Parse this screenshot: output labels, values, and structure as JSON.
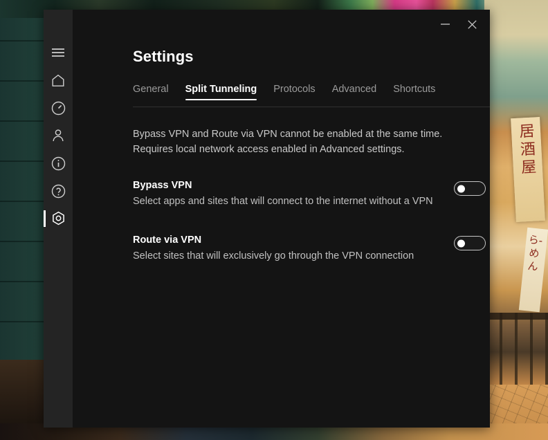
{
  "desktop": {
    "background_description": "japanese-street-photo",
    "sign_primary_text": "居酒屋",
    "sign_secondary_text": "ら-めん"
  },
  "window": {
    "titlebar": {
      "minimize_label": "—",
      "minimize_icon": "minimize-icon",
      "close_label": "✕",
      "close_icon": "close-icon"
    }
  },
  "sidebar": {
    "items": [
      {
        "id": "menu",
        "icon": "hamburger-menu-icon",
        "active": false
      },
      {
        "id": "home",
        "icon": "home-icon",
        "active": false
      },
      {
        "id": "speed",
        "icon": "speedometer-icon",
        "active": false
      },
      {
        "id": "account",
        "icon": "person-icon",
        "active": false
      },
      {
        "id": "info",
        "icon": "info-circle-icon",
        "active": false
      },
      {
        "id": "help",
        "icon": "question-circle-icon",
        "active": false
      },
      {
        "id": "settings",
        "icon": "settings-nut-icon",
        "active": true
      }
    ]
  },
  "page": {
    "title": "Settings"
  },
  "tabs": [
    {
      "label": "General",
      "active": false
    },
    {
      "label": "Split Tunneling",
      "active": true
    },
    {
      "label": "Protocols",
      "active": false
    },
    {
      "label": "Advanced",
      "active": false
    },
    {
      "label": "Shortcuts",
      "active": false
    }
  ],
  "notice": {
    "line1": "Bypass VPN and Route via VPN cannot be enabled at the same time.",
    "line2": "Requires local network access enabled in Advanced settings."
  },
  "settings": [
    {
      "id": "bypass-vpn",
      "title": "Bypass VPN",
      "description": "Select apps and sites that will connect to the internet without a VPN",
      "toggle_state": "off"
    },
    {
      "id": "route-via-vpn",
      "title": "Route via VPN",
      "description": "Select sites that will exclusively go through the VPN connection",
      "toggle_state": "off"
    }
  ],
  "colors": {
    "window_bg": "#141414",
    "sidebar_bg": "#242424",
    "accent_active": "#ffffff",
    "text_primary": "#ffffff",
    "text_secondary": "#c0c0c0",
    "text_muted": "#9b9b9b"
  }
}
